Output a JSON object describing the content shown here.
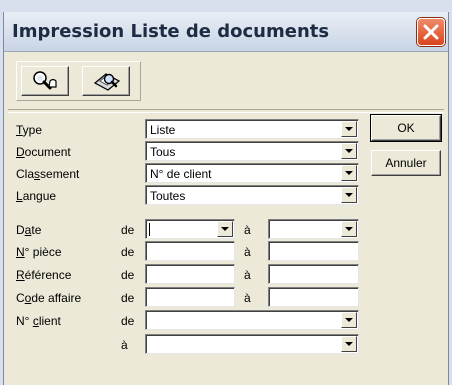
{
  "window": {
    "title": "Impression Liste de documents"
  },
  "toolbar": {
    "search_icon": "search-people-icon",
    "preview_icon": "print-preview-icon"
  },
  "form": {
    "type": {
      "label_pre": "",
      "label_u": "T",
      "label_post": "ype",
      "value": "Liste"
    },
    "document": {
      "label_pre": "",
      "label_u": "D",
      "label_post": "ocument",
      "value": "Tous"
    },
    "classement": {
      "label_pre": "Cla",
      "label_u": "s",
      "label_post": "sement",
      "value": "N° de client"
    },
    "langue": {
      "label_pre": "",
      "label_u": "L",
      "label_post": "angue",
      "value": "Toutes"
    },
    "date": {
      "label_pre": "D",
      "label_u": "a",
      "label_post": "te",
      "from": "",
      "to": ""
    },
    "piece": {
      "label_pre": "",
      "label_u": "N",
      "label_post": "° pièce",
      "from": "",
      "to": ""
    },
    "reference": {
      "label_pre": "",
      "label_u": "R",
      "label_post": "éférence",
      "from": "",
      "to": ""
    },
    "code_affaire": {
      "label_pre": "C",
      "label_u": "o",
      "label_post": "de affaire",
      "from": "",
      "to": ""
    },
    "client": {
      "label_pre": "N° ",
      "label_u": "c",
      "label_post": "lient",
      "from": "",
      "to": ""
    },
    "de": "de",
    "a": "à"
  },
  "buttons": {
    "ok": "OK",
    "cancel": "Annuler"
  }
}
